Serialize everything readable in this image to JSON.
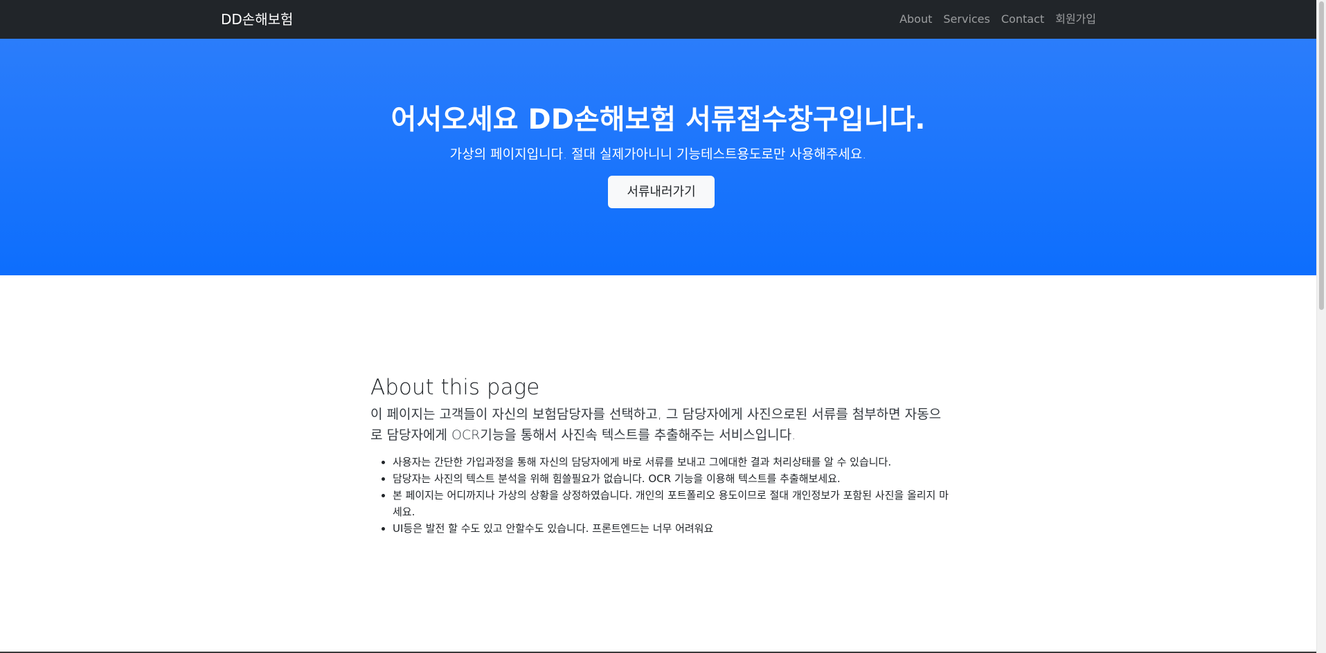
{
  "navbar": {
    "brand": "DD손해보험",
    "links": [
      "About",
      "Services",
      "Contact",
      "회원가입"
    ]
  },
  "hero": {
    "title": "어서오세요 DD손해보험 서류접수창구입니다.",
    "subtitle": "가상의 페이지입니다. 절대 실제가아니니 기능테스트용도로만 사용해주세요.",
    "button_label": "서류내러가기"
  },
  "about": {
    "title": "About this page",
    "lead": "이 페이지는 고객들이 자신의 보험담당자를 선택하고, 그 담당자에게 사진으로된 서류를 첨부하면 자동으로 담당자에게 OCR기능을 통해서 사진속 텍스트를 추출해주는 서비스입니다.",
    "items": [
      "사용자는 간단한 가입과정을 통해 자신의 담당자에게 바로 서류를 보내고 그에대한 결과 처리상태를 알 수 있습니다.",
      "담당자는 사진의 텍스트 분석을 위해 힘쓸필요가 없습니다. OCR 기능을 이용해 텍스트를 추출해보세요.",
      "본 페이지는 어디까지나 가상의 상황을 상정하였습니다. 개인의 포트폴리오 용도이므로 절대 개인정보가 포함된 사진을 올리지 마세요.",
      "UI등은 발전 할 수도 있고 안할수도 있습니다. 프론트엔드는 너무 어려워요"
    ]
  },
  "colors": {
    "navbar_bg": "#212529",
    "hero_bg": "#0d6efd",
    "button_bg": "#f8f9fa"
  }
}
